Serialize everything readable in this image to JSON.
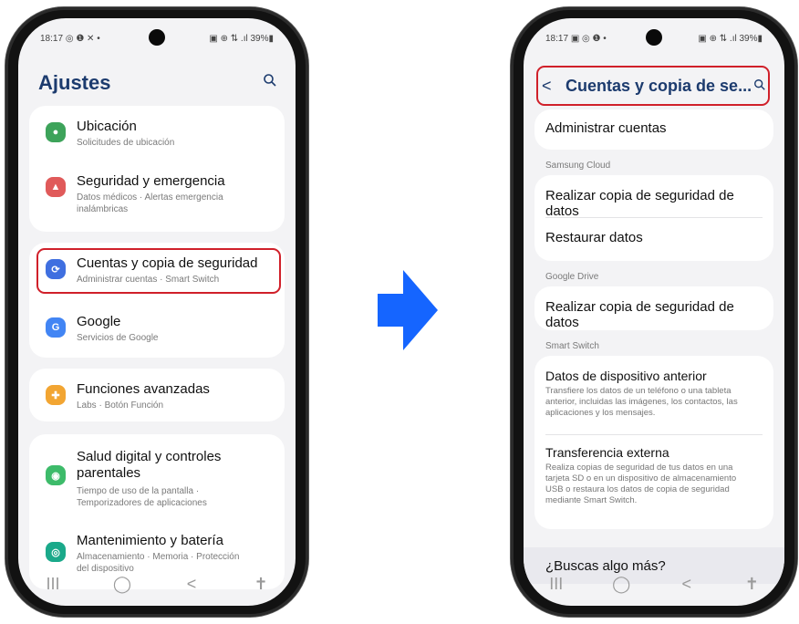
{
  "left_phone": {
    "status_time": "18:17",
    "status_left_icons": "◎ ❶ ✕ •",
    "status_right": "▣ ⊕ ⇅ .ıl 39%▮",
    "title": "Ajustes",
    "search_icon": "magnifier",
    "items": [
      {
        "title": "Ubicación",
        "subtitle": "Solicitudes de ubicación",
        "icon": "location-pin",
        "color": "#3da35a"
      },
      {
        "title": "Seguridad y emergencia",
        "subtitle": "Datos médicos · Alertas emergencia inalámbricas",
        "icon": "siren",
        "color": "#e05a5a"
      },
      {
        "title": "Cuentas y copia de seguridad",
        "subtitle": "Administrar cuentas · Smart Switch",
        "icon": "sync",
        "color": "#3f6fe0"
      },
      {
        "title": "Google",
        "subtitle": "Servicios de Google",
        "icon": "google-g",
        "color": "#4285f4"
      },
      {
        "title": "Funciones avanzadas",
        "subtitle": "Labs · Botón Función",
        "icon": "gear-plus",
        "color": "#f2a532"
      },
      {
        "title": "Salud digital y controles parentales",
        "subtitle": "Tiempo de uso de la pantalla · Temporizadores de aplicaciones",
        "icon": "circle-check",
        "color": "#3dbb6a"
      },
      {
        "title": "Mantenimiento y batería",
        "subtitle": "Almacenamiento · Memoria · Protección del dispositivo",
        "icon": "refresh-circle",
        "color": "#1aa98a"
      }
    ],
    "nav": [
      "III",
      "◯",
      "<",
      "✝"
    ]
  },
  "right_phone": {
    "status_time": "18:17",
    "status_left_icons": "▣ ◎ ❶ •",
    "status_right": "▣ ⊕ ⇅ .ıl 39%▮",
    "title": "Cuentas y copia de se...",
    "rows": {
      "administrar": "Administrar cuentas",
      "samsung_cloud": "Samsung Cloud",
      "backup1": "Realizar copia de seguridad de datos",
      "restaurar": "Restaurar datos",
      "google_drive": "Google Drive",
      "backup2": "Realizar copia de seguridad de datos",
      "smart_switch": "Smart Switch",
      "datos_dispositivo": "Datos de dispositivo anterior",
      "datos_dispositivo_desc": "Transfiere los datos de un teléfono o una tableta anterior, incluidas las imágenes, los contactos, las aplicaciones y los mensajes.",
      "transferencia": "Transferencia externa",
      "transferencia_desc": "Realiza copias de seguridad de tus datos en una tarjeta SD o en un dispositivo de almacenamiento USB o restaura los datos de copia de seguridad mediante Smart Switch.",
      "buscas": "¿Buscas algo más?"
    },
    "nav": [
      "III",
      "◯",
      "<",
      "✝"
    ]
  },
  "colors": {
    "highlight": "#d0202a",
    "arrow": "#1565ff",
    "title": "#1c3b6e"
  }
}
